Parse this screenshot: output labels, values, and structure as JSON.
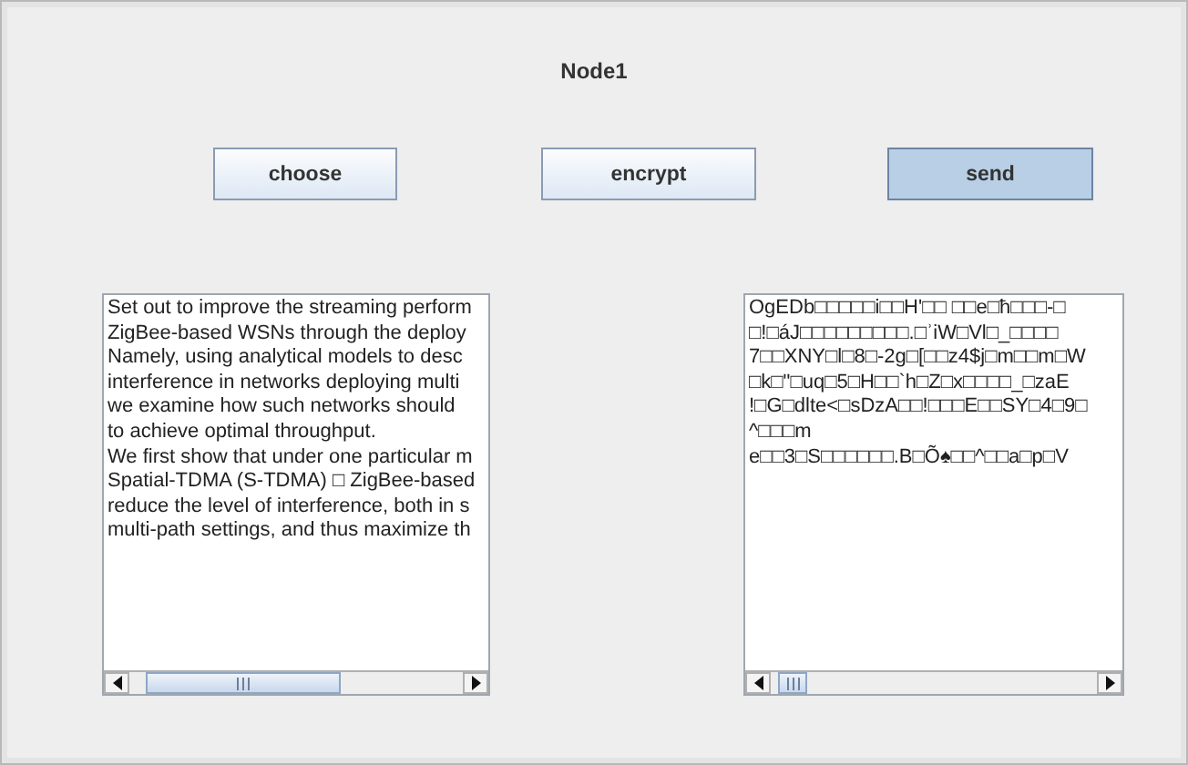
{
  "window": {
    "title": "Node1"
  },
  "buttons": [
    {
      "label": "choose",
      "pressed": false
    },
    {
      "label": "encrypt",
      "pressed": false
    },
    {
      "label": "send",
      "pressed": true
    }
  ],
  "text_areas": [
    {
      "lines": [
        "Set out to improve the streaming perform",
        "ZigBee-based WSNs through the deploy",
        "Namely, using analytical models to desc",
        "interference in networks deploying multi",
        "we examine how such networks should",
        "to achieve optimal throughput.",
        "We first show that under one particular m",
        "Spatial-TDMA (S-TDMA) □ ZigBee-based",
        "reduce the level of interference, both in s",
        "multi-path settings, and thus maximize th"
      ]
    },
    {
      "lines": [
        "OgEDb□□□□□i□□H'□□ □□e□ħ□□□-□",
        "□!□áJ□□□□□□□□□.□ʾiW□Vl□_□□□□",
        "7□□XNY□l□8□-2g□[□□z4$j□m□□m□W",
        "□k□\"□uq□5□H□□`h□Z□x□□□□_□zaE",
        "!□G□dlte<□sDzA□□!□□□E□□SY□4□9□",
        "^□□□m",
        "e□□3□S□□□□□□.B□Õ♠□□^□□a□p□V"
      ]
    }
  ]
}
